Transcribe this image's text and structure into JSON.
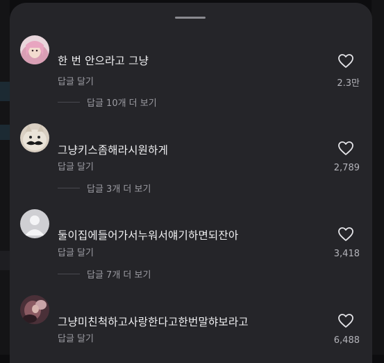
{
  "comments": [
    {
      "text": "한 번 안으라고 그냥",
      "reply_label": "답글 달기",
      "more_replies": "답글 10개 더 보기",
      "likes": "2.3만",
      "avatar": "pink-hair-avatar"
    },
    {
      "text": "그냥키스좀해라시원하게",
      "reply_label": "답글 달기",
      "more_replies": "답글 3개 더 보기",
      "likes": "2,789",
      "avatar": "cat-mustache-avatar"
    },
    {
      "text": "둘이집에들어가서누워서얘기하면되잔아",
      "reply_label": "답글 달기",
      "more_replies": "답글 7개 더 보기",
      "likes": "3,418",
      "avatar": "default-user-avatar"
    },
    {
      "text": "그냥미친척하고사랑한다고한번말햐보라고",
      "reply_label": "답글 달기",
      "more_replies": "",
      "likes": "6,488",
      "avatar": "photo-avatar"
    }
  ],
  "colors": {
    "sheet": "#252529",
    "text": "#f2f2f4",
    "muted": "#9c9ca2"
  },
  "icons": {
    "like": "heart-outline-icon"
  }
}
